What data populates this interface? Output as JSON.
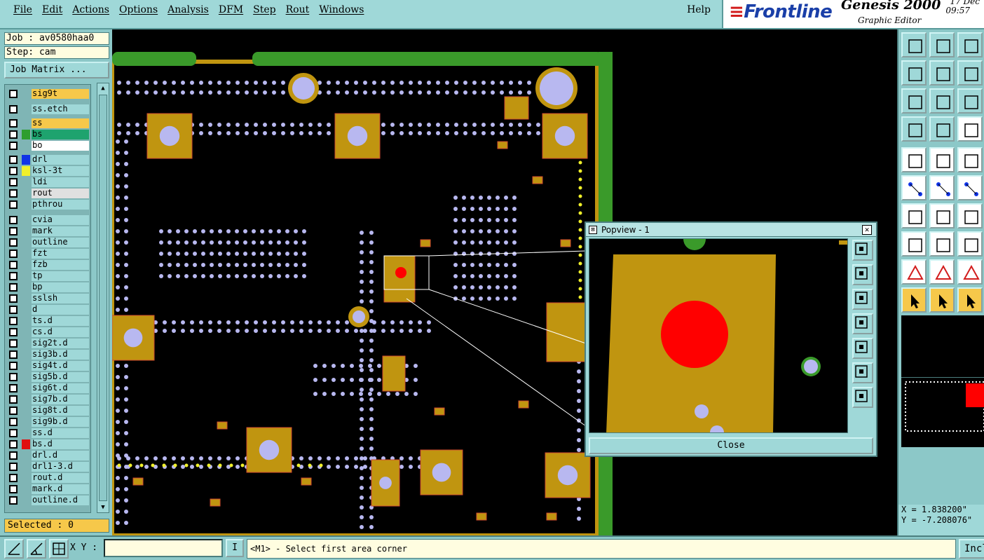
{
  "menu": {
    "items": [
      "File",
      "Edit",
      "Actions",
      "Options",
      "Analysis",
      "DFM",
      "Step",
      "Rout",
      "Windows"
    ],
    "help": "Help"
  },
  "brand": {
    "logo": "Frontline",
    "product": "Genesis 2000",
    "subtitle": "Graphic Editor",
    "date": "17 Dec",
    "time": "09:57"
  },
  "left": {
    "job": "Job : av0580haa0",
    "step": "Step: cam",
    "job_matrix": "Job Matrix ...",
    "selected": "Selected : 0",
    "layers": [
      {
        "name": "sig9t",
        "color": "#f6c84a",
        "swatch": ""
      },
      {
        "name": "ss.etch",
        "color": "#9fd8d8",
        "swatch": ""
      },
      {
        "name": "ss",
        "color": "#f6c84a",
        "swatch": ""
      },
      {
        "name": "bs",
        "color": "#1ea36e",
        "swatch": "#2e9e2e"
      },
      {
        "name": "bo",
        "color": "#ffffff",
        "swatch": ""
      },
      {
        "name": "drl",
        "color": "#9fd8d8",
        "swatch": "#1034e6"
      },
      {
        "name": "ksl-3t",
        "color": "#9fd8d8",
        "swatch": "#f0f02a"
      },
      {
        "name": "ldi",
        "color": "#9fd8d8",
        "swatch": ""
      },
      {
        "name": "rout",
        "color": "#e0e0e0",
        "swatch": ""
      },
      {
        "name": "pthrou",
        "color": "#9fd8d8",
        "swatch": ""
      },
      {
        "name": "cvia",
        "color": "#9fd8d8",
        "swatch": ""
      },
      {
        "name": "mark",
        "color": "#9fd8d8",
        "swatch": ""
      },
      {
        "name": "outline",
        "color": "#9fd8d8",
        "swatch": ""
      },
      {
        "name": "fzt",
        "color": "#9fd8d8",
        "swatch": ""
      },
      {
        "name": "fzb",
        "color": "#9fd8d8",
        "swatch": ""
      },
      {
        "name": "tp",
        "color": "#9fd8d8",
        "swatch": ""
      },
      {
        "name": "bp",
        "color": "#9fd8d8",
        "swatch": ""
      },
      {
        "name": "sslsh",
        "color": "#9fd8d8",
        "swatch": ""
      },
      {
        "name": "d",
        "color": "#9fd8d8",
        "swatch": ""
      },
      {
        "name": "ts.d",
        "color": "#9fd8d8",
        "swatch": ""
      },
      {
        "name": "cs.d",
        "color": "#9fd8d8",
        "swatch": ""
      },
      {
        "name": "sig2t.d",
        "color": "#9fd8d8",
        "swatch": ""
      },
      {
        "name": "sig3b.d",
        "color": "#9fd8d8",
        "swatch": ""
      },
      {
        "name": "sig4t.d",
        "color": "#9fd8d8",
        "swatch": ""
      },
      {
        "name": "sig5b.d",
        "color": "#9fd8d8",
        "swatch": ""
      },
      {
        "name": "sig6t.d",
        "color": "#9fd8d8",
        "swatch": ""
      },
      {
        "name": "sig7b.d",
        "color": "#9fd8d8",
        "swatch": ""
      },
      {
        "name": "sig8t.d",
        "color": "#9fd8d8",
        "swatch": ""
      },
      {
        "name": "sig9b.d",
        "color": "#9fd8d8",
        "swatch": ""
      },
      {
        "name": "ss.d",
        "color": "#9fd8d8",
        "swatch": ""
      },
      {
        "name": "bs.d",
        "color": "#9fd8d8",
        "swatch": "#e01010"
      },
      {
        "name": "drl.d",
        "color": "#9fd8d8",
        "swatch": ""
      },
      {
        "name": "drl1-3.d",
        "color": "#9fd8d8",
        "swatch": ""
      },
      {
        "name": "rout.d",
        "color": "#9fd8d8",
        "swatch": ""
      },
      {
        "name": "mark.d",
        "color": "#9fd8d8",
        "swatch": ""
      },
      {
        "name": "outline.d",
        "color": "#9fd8d8",
        "swatch": ""
      }
    ]
  },
  "popview": {
    "title": "Popview - 1",
    "close": "Close"
  },
  "coords": {
    "x": "X = 1.838200\"",
    "y": "Y = -7.208076\""
  },
  "bottom": {
    "xy_label": "X Y :",
    "xy_value": "",
    "i_button": "I",
    "prompt": "<M1> - Select first area corner",
    "incl": "Incl"
  },
  "colors": {
    "pad": "#c09510",
    "pad_edge": "#d04a30",
    "via": "#b8b8f0",
    "green": "#3a9a2a",
    "red": "#ff0000",
    "yellow": "#f0f02a"
  }
}
